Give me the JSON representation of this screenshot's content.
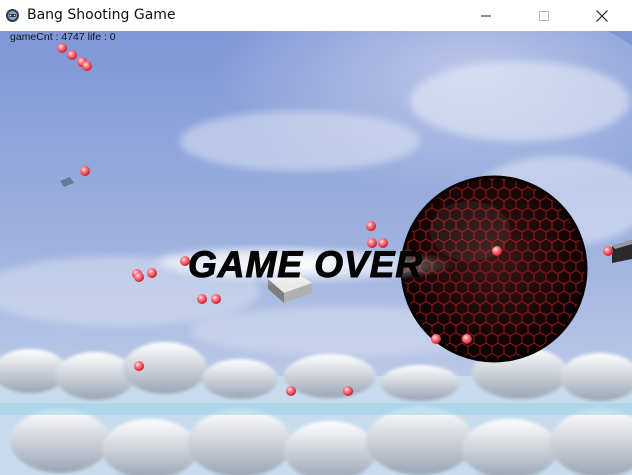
{
  "window": {
    "title": "Bang Shooting Game",
    "icons": {
      "app": "game-controller-icon",
      "minimize": "minimize-icon",
      "maximize": "maximize-icon",
      "close": "close-icon"
    }
  },
  "hud": {
    "text": "gameCnt : 4747 life : 0"
  },
  "game_over": {
    "text": "GAME OVER"
  },
  "colors": {
    "sky": "#8ea3d8",
    "bullet": "#ff5a66",
    "boss_shell": "#1a0c0c",
    "boss_grid": "#b01818",
    "cloud": "#f2f4f8"
  }
}
